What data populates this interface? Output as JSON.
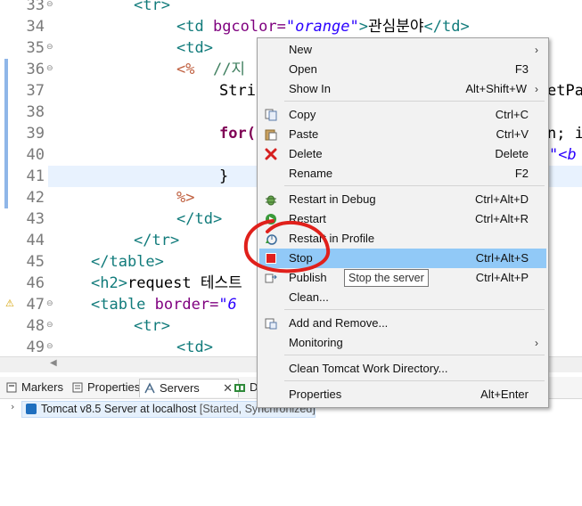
{
  "editor": {
    "lines": [
      {
        "n": "33",
        "fold": "⊖"
      },
      {
        "n": "34",
        "fold": ""
      },
      {
        "n": "35",
        "fold": "⊖"
      },
      {
        "n": "36",
        "fold": "⊖"
      },
      {
        "n": "37",
        "fold": ""
      },
      {
        "n": "38",
        "fold": ""
      },
      {
        "n": "39",
        "fold": ""
      },
      {
        "n": "40",
        "fold": ""
      },
      {
        "n": "41",
        "fold": ""
      },
      {
        "n": "42",
        "fold": ""
      },
      {
        "n": "43",
        "fold": ""
      },
      {
        "n": "44",
        "fold": ""
      },
      {
        "n": "45",
        "fold": ""
      },
      {
        "n": "46",
        "fold": ""
      },
      {
        "n": "47",
        "fold": "⊖"
      },
      {
        "n": "48",
        "fold": "⊖"
      },
      {
        "n": "49",
        "fold": "⊖"
      }
    ],
    "code": {
      "l33_tag": "<tr>",
      "l34_open": "<td",
      "l34_attr": " bgcolor=",
      "l34_val": "\"orange\"",
      "l34_close": ">",
      "l34_text": "관심분야",
      "l34_end": "</td>",
      "l35": "<td>",
      "l36_jsp": "<%",
      "l36_cmt": "  //지",
      "l37": "Stri",
      "l37_right": "etPa",
      "l39_kw": "for(",
      "l39_right": "n; i",
      "l40_str": "\"<b",
      "l41": "}",
      "l42_jsp": "%>",
      "l43": "</td>",
      "l44": "</tr>",
      "l45": "</table>",
      "l46_tag": "<h2>",
      "l46_text": "request 테스트",
      "l47_tag": "<table",
      "l47_attr": " border=",
      "l47_val": "\"6",
      "l48": "<tr>",
      "l49": "<td>"
    }
  },
  "panel": {
    "tabs": [
      {
        "label": "Markers"
      },
      {
        "label": "Properties"
      },
      {
        "label": "Servers"
      },
      {
        "label": "Da"
      }
    ],
    "close_glyph": "✕",
    "server_row": {
      "name": "Tomcat v8.5 Server at localhost",
      "status": "[Started, Synchronized]"
    }
  },
  "context_menu": {
    "items": [
      {
        "label": "New",
        "shortcut": "",
        "submenu": true
      },
      {
        "label": "Open",
        "shortcut": "F3"
      },
      {
        "label": "Show In",
        "shortcut": "Alt+Shift+W",
        "submenu": true
      },
      {
        "label": "Copy",
        "shortcut": "Ctrl+C",
        "icon": "copy-icon"
      },
      {
        "label": "Paste",
        "shortcut": "Ctrl+V",
        "icon": "paste-icon"
      },
      {
        "label": "Delete",
        "shortcut": "Delete",
        "icon": "delete-icon"
      },
      {
        "label": "Rename",
        "shortcut": "F2"
      },
      {
        "label": "Restart in Debug",
        "shortcut": "Ctrl+Alt+D",
        "icon": "debug-icon"
      },
      {
        "label": "Restart",
        "shortcut": "Ctrl+Alt+R",
        "icon": "restart-icon"
      },
      {
        "label": "Restart in Profile",
        "shortcut": "",
        "icon": "profile-icon"
      },
      {
        "label": "Stop",
        "shortcut": "Ctrl+Alt+S",
        "icon": "stop-icon",
        "highlighted": true
      },
      {
        "label": "Publish",
        "shortcut": "Ctrl+Alt+P",
        "icon": "publish-icon"
      },
      {
        "label": "Clean...",
        "shortcut": ""
      },
      {
        "label": "Add and Remove...",
        "shortcut": ""
      },
      {
        "label": "Monitoring",
        "shortcut": "",
        "submenu": true
      },
      {
        "label": "Clean Tomcat Work Directory...",
        "shortcut": ""
      },
      {
        "label": "Properties",
        "shortcut": "Alt+Enter"
      }
    ],
    "submenu_glyph": "›"
  },
  "tooltip": {
    "text": "Stop the server"
  },
  "colors": {
    "menu_highlight": "#91c9f7",
    "annotation_red": "#e0201b",
    "stop_red": "#e02020"
  }
}
